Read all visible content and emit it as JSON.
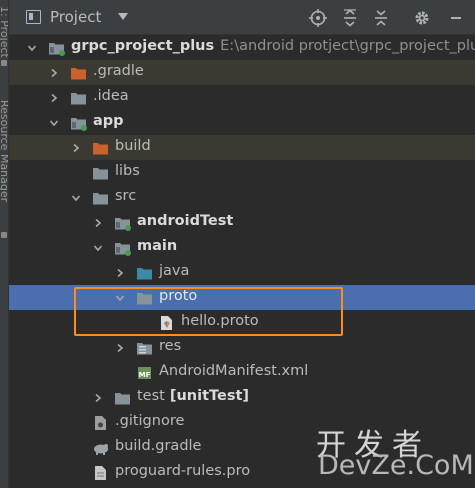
{
  "left_strip": {
    "tab1": "1: Project",
    "tab2": "Resource Manager"
  },
  "header": {
    "title": "Project",
    "icons": [
      "project-view-icon",
      "locate-icon",
      "expand-all-icon",
      "collapse-all-icon",
      "gear-icon",
      "minimize-icon"
    ]
  },
  "tree": [
    {
      "label": "grpc_project_plus",
      "path": "E:\\android protject\\grpc_project_plus",
      "icon": "module-folder",
      "arrow": "down",
      "bold": true
    },
    {
      "label": ".gradle",
      "icon": "orange-folder",
      "arrow": "right"
    },
    {
      "label": ".idea",
      "icon": "gray-folder",
      "arrow": "right"
    },
    {
      "label": "app",
      "icon": "module-folder",
      "arrow": "down",
      "bold": true
    },
    {
      "label": "build",
      "icon": "orange-folder",
      "arrow": "right"
    },
    {
      "label": "libs",
      "icon": "gray-folder",
      "arrow": "none"
    },
    {
      "label": "src",
      "icon": "gray-folder",
      "arrow": "down"
    },
    {
      "label": "androidTest",
      "icon": "module-folder",
      "arrow": "right",
      "bold": true
    },
    {
      "label": "main",
      "icon": "module-folder",
      "arrow": "down",
      "bold": true
    },
    {
      "label": "java",
      "icon": "source-folder",
      "arrow": "right"
    },
    {
      "label": "proto",
      "icon": "gray-folder",
      "arrow": "down",
      "selected": true
    },
    {
      "label": "hello.proto",
      "icon": "proto-file",
      "arrow": "none"
    },
    {
      "label": "res",
      "icon": "res-folder",
      "arrow": "right"
    },
    {
      "label": "AndroidManifest.xml",
      "icon": "manifest-file",
      "arrow": "none"
    },
    {
      "label": "test",
      "suffix": "[unitTest]",
      "icon": "gray-folder",
      "arrow": "right"
    },
    {
      "label": ".gitignore",
      "icon": "gitignore-file",
      "arrow": "none"
    },
    {
      "label": "build.gradle",
      "icon": "gradle-file",
      "arrow": "none"
    },
    {
      "label": "proguard-rules.pro",
      "icon": "text-file",
      "arrow": "none"
    }
  ],
  "watermark": {
    "cn": "开发者",
    "en": "DevZe.CoM"
  },
  "colors": {
    "selection": "#4b6eaf",
    "annotation_box": "#ff8c1a",
    "excluded_folder": "#c9622c"
  }
}
